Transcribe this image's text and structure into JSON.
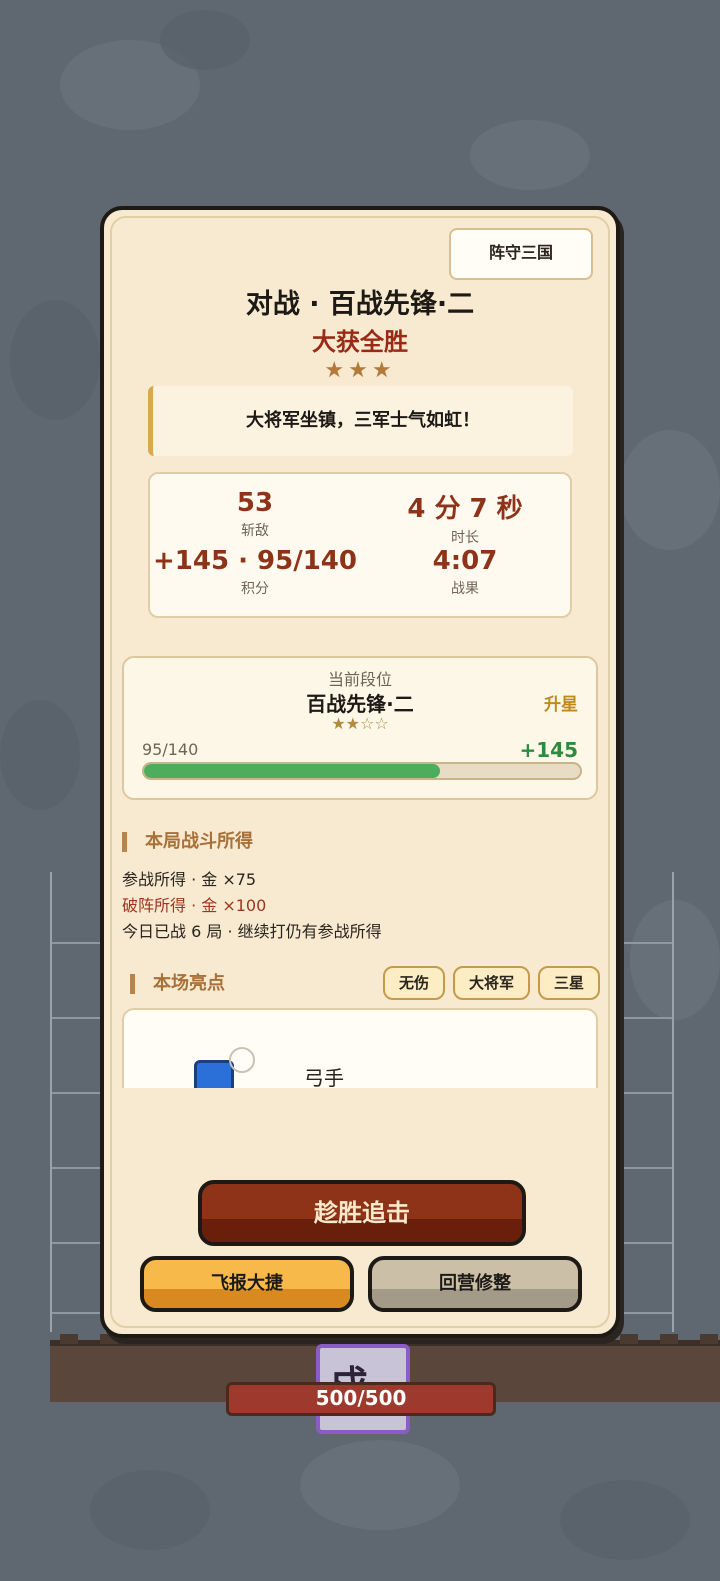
{
  "colors": {
    "accent": "#8e3318",
    "gold": "#b47a3c",
    "progress": "#4cae5c",
    "panel": "#f7ead0"
  },
  "mode_tag": "阵守三国",
  "header": {
    "title": "对战 · 百战先锋·二",
    "result": "大获全胜",
    "stars": "★★★"
  },
  "quote": "大将军坐镇，三军士气如虹！",
  "stats": [
    {
      "value": "53",
      "label": "斩敌"
    },
    {
      "value": "4 分 7 秒",
      "label": "时长"
    },
    {
      "value": "+145 · 95/140",
      "label": "积分"
    },
    {
      "value": "4:07",
      "label": "战果"
    }
  ],
  "rank": {
    "caption": "当前段位",
    "name": "百战先锋·二",
    "stars": "★★☆☆",
    "promo": "升星",
    "progress_text": "95/140",
    "gain": "+145",
    "progress_fraction": 0.68
  },
  "rewards": {
    "title": "本局战斗所得",
    "lines": [
      "参战所得 · 金 ×75",
      "破阵所得 · 金 ×100",
      "今日已战 6 局 · 继续打仍有参战所得"
    ]
  },
  "highlights": {
    "title": "本场亮点",
    "chips": [
      "无伤",
      "大将军",
      "三星"
    ],
    "unit_name": "弓手"
  },
  "buttons": {
    "pursue": "趁胜追击",
    "share": "飞报大捷",
    "back": "回营修整"
  },
  "game": {
    "tower_glyph": "戍",
    "tower_hp": "500/500"
  }
}
